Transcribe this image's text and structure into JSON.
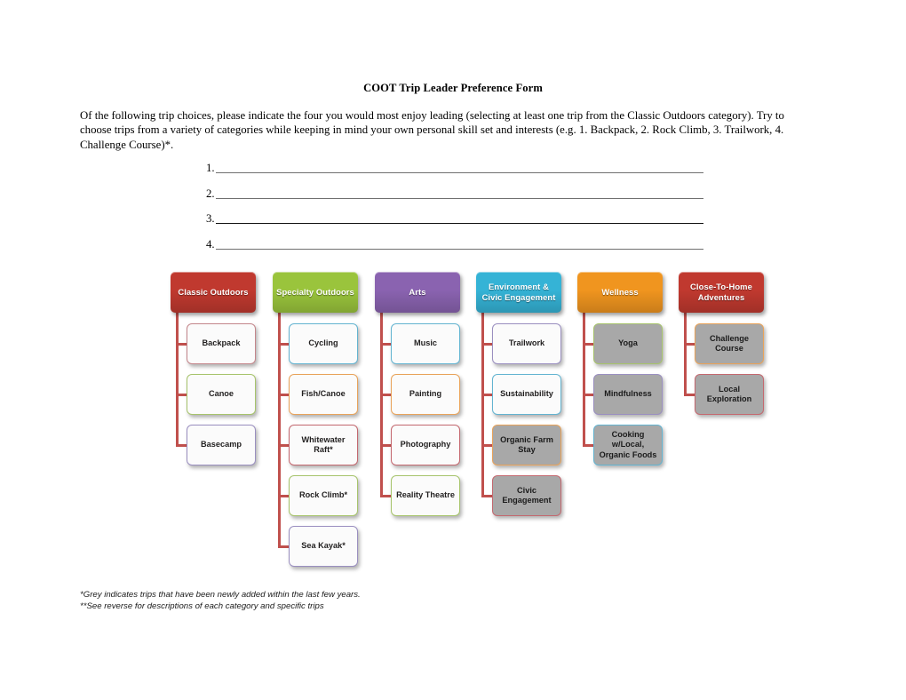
{
  "document": {
    "title": "COOT Trip Leader Preference Form",
    "paragraph": "Of the following trip choices, please indicate the four you would most enjoy leading (selecting at least one trip from the Classic Outdoors category).  Try to choose trips from a variety of categories while keeping in mind your own personal skill set and interests (e.g. 1. Backpack, 2. Rock Climb, 3. Trailwork, 4. Challenge Course)*."
  },
  "answer_lines": [
    {
      "number": "1.",
      "value": "",
      "style": "grey"
    },
    {
      "number": "2.",
      "value": "",
      "style": "grey"
    },
    {
      "number": "3.",
      "value": "",
      "style": "dark"
    },
    {
      "number": "4.",
      "value": "",
      "style": "grey"
    }
  ],
  "chart_data": {
    "type": "diagram",
    "layout": "org-chart-columns",
    "connector_color": "#c0504d",
    "grey_fill_color": "#a8a8a8",
    "columns": [
      {
        "header": "Classic Outdoors",
        "header_color": "#c0392f",
        "items": [
          {
            "label": "Backpack",
            "border_color": "#c4868b",
            "filled": false
          },
          {
            "label": "Canoe",
            "border_color": "#a7c46c",
            "filled": false
          },
          {
            "label": "Basecamp",
            "border_color": "#9a8fc0",
            "filled": false
          }
        ]
      },
      {
        "header": "Specialty Outdoors",
        "header_color": "#9ac43c",
        "items": [
          {
            "label": "Cycling",
            "border_color": "#63b4d1",
            "filled": false
          },
          {
            "label": "Fish/Canoe",
            "border_color": "#e9a35a",
            "filled": false
          },
          {
            "label": "Whitewater Raft*",
            "border_color": "#c4686f",
            "filled": false
          },
          {
            "label": "Rock Climb*",
            "border_color": "#a7c46c",
            "filled": false
          },
          {
            "label": "Sea Kayak*",
            "border_color": "#9a8fc0",
            "filled": false
          }
        ]
      },
      {
        "header": "Arts",
        "header_color": "#8a63b0",
        "items": [
          {
            "label": "Music",
            "border_color": "#63b4d1",
            "filled": false
          },
          {
            "label": "Painting",
            "border_color": "#e9a35a",
            "filled": false
          },
          {
            "label": "Photography",
            "border_color": "#c4686f",
            "filled": false
          },
          {
            "label": "Reality Theatre",
            "border_color": "#a7c46c",
            "filled": false
          }
        ]
      },
      {
        "header": "Environment & Civic Engagement",
        "header_color": "#35b3d6",
        "items": [
          {
            "label": "Trailwork",
            "border_color": "#9a8fc0",
            "filled": false
          },
          {
            "label": "Sustainability",
            "border_color": "#63b4d1",
            "filled": false
          },
          {
            "label": "Organic Farm Stay",
            "border_color": "#e9a35a",
            "filled": true
          },
          {
            "label": "Civic Engagement",
            "border_color": "#c4686f",
            "filled": true
          }
        ]
      },
      {
        "header": "Wellness",
        "header_color": "#f0951f",
        "items": [
          {
            "label": "Yoga",
            "border_color": "#a7c46c",
            "filled": true
          },
          {
            "label": "Mindfulness",
            "border_color": "#9a8fc0",
            "filled": true
          },
          {
            "label": "Cooking w/Local, Organic Foods",
            "border_color": "#63b4d1",
            "filled": true
          }
        ]
      },
      {
        "header": "Close-To-Home Adventures",
        "header_color": "#c0392f",
        "items": [
          {
            "label": "Challenge Course",
            "border_color": "#e9a35a",
            "filled": true
          },
          {
            "label": "Local Exploration",
            "border_color": "#c4686f",
            "filled": true
          }
        ]
      }
    ]
  },
  "footnotes": [
    "*Grey indicates trips that have been newly added within the last few years.",
    "**See reverse for descriptions of each category and specific trips"
  ]
}
